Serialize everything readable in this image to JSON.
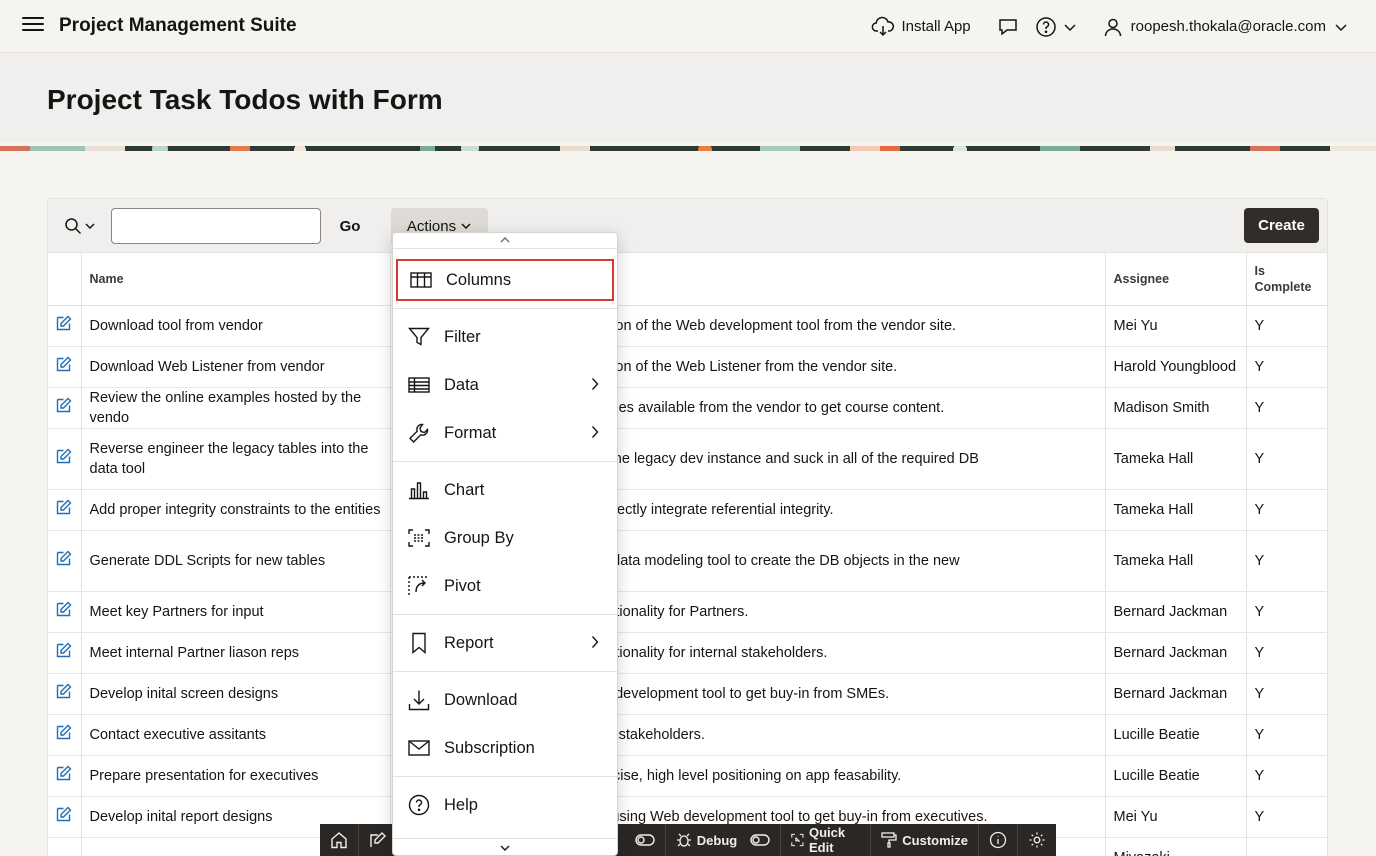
{
  "header": {
    "app_title": "Project Management Suite",
    "install_app": "Install App",
    "user": "roopesh.thokala@oracle.com"
  },
  "page": {
    "title": "Project Task Todos with Form"
  },
  "toolbar": {
    "search_value": "",
    "go_label": "Go",
    "actions_label": "Actions",
    "create_label": "Create"
  },
  "table": {
    "columns": [
      "Name",
      "Assignee",
      "Is Complete"
    ],
    "rows": [
      {
        "name": "Download tool from vendor",
        "description": "available version of the Web development tool from the vendor site.",
        "assignee": "Mei Yu",
        "complete": "Y"
      },
      {
        "name": "Download Web Listener from vendor",
        "description": "available version of the Web Listener from the vendor site.",
        "assignee": "Harold Youngblood",
        "complete": "Y"
      },
      {
        "name": "Review the online examples hosted by the vendo",
        "description": "nerous examples available from the vendor to get course content.",
        "assignee": "Madison Smith",
        "complete": "Y"
      },
      {
        "name": "Reverse engineer the legacy tables into the data tool",
        "description": "deling tool to the legacy dev instance and suck in all of the required DB",
        "assignee": "Tameka Hall",
        "complete": "Y"
      },
      {
        "name": "Add proper integrity constraints to the entities",
        "description": "needed to correctly integrate referential integrity.",
        "assignee": "Tameka Hall",
        "complete": "Y"
      },
      {
        "name": "Generate DDL Scripts for new tables",
        "description": "ripts from the data modeling tool to create the DB objects in the new",
        "assignee": "Tameka Hall",
        "complete": "Y"
      },
      {
        "name": "Meet key Partners for input",
        "description": "important functionality for Partners.",
        "assignee": "Bernard Jackman",
        "complete": "Y"
      },
      {
        "name": "Meet internal Partner liason reps",
        "description": "important functionality for internal stakeholders.",
        "assignee": "Bernard Jackman",
        "complete": "Y"
      },
      {
        "name": "Develop inital screen designs",
        "description": "ns using Web development tool to get buy-in from SMEs.",
        "assignee": "Bernard Jackman",
        "complete": "Y"
      },
      {
        "name": "Contact executive assitants",
        "description": "led for the key stakeholders.",
        "assignee": "Lucille Beatie",
        "complete": "Y"
      },
      {
        "name": "Prepare presentation for executives",
        "description": "delivering concise, high level positioning on app feasability.",
        "assignee": "Lucille Beatie",
        "complete": "Y"
      },
      {
        "name": "Develop inital report designs",
        "description": "oard screens using Web development tool to get buy-in from executives.",
        "assignee": "Mei Yu",
        "complete": "Y"
      },
      {
        "name": "",
        "description": "",
        "assignee": "Miyazaki",
        "complete": ""
      }
    ]
  },
  "actions_menu": {
    "items": [
      "Columns",
      "Filter",
      "Data",
      "Format",
      "Chart",
      "Group By",
      "Pivot",
      "Report",
      "Download",
      "Subscription",
      "Help"
    ]
  },
  "devbar": {
    "items": [
      "Debug",
      "Quick Edit",
      "Customize"
    ]
  }
}
